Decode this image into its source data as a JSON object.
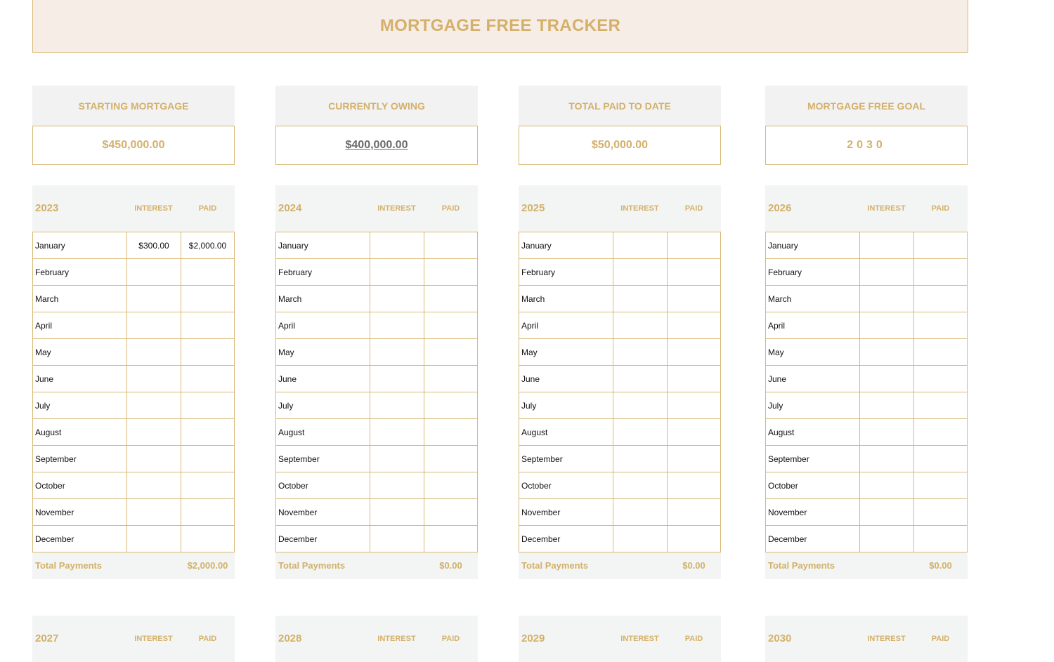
{
  "title": "MORTGAGE FREE TRACKER",
  "stats": [
    {
      "label": "STARTING MORTGAGE",
      "value": "$450,000.00"
    },
    {
      "label": "CURRENTLY OWING",
      "value": "$400,000.00"
    },
    {
      "label": "TOTAL PAID TO DATE",
      "value": "$50,000.00"
    },
    {
      "label": "MORTGAGE FREE GOAL",
      "value": "2030"
    }
  ],
  "column_headers": {
    "interest": "INTEREST",
    "paid": "PAID"
  },
  "total_label": "Total Payments",
  "months": [
    "January",
    "February",
    "March",
    "April",
    "May",
    "June",
    "July",
    "August",
    "September",
    "October",
    "November",
    "December"
  ],
  "years": [
    {
      "year": "2023",
      "rows": [
        {
          "interest": "$300.00",
          "paid": "$2,000.00"
        }
      ],
      "total": "$2,000.00"
    },
    {
      "year": "2024",
      "rows": [],
      "total": "$0.00"
    },
    {
      "year": "2025",
      "rows": [],
      "total": "$0.00"
    },
    {
      "year": "2026",
      "rows": [],
      "total": "$0.00"
    },
    {
      "year": "2027",
      "rows": [],
      "total": ""
    },
    {
      "year": "2028",
      "rows": [],
      "total": ""
    },
    {
      "year": "2029",
      "rows": [],
      "total": ""
    },
    {
      "year": "2030",
      "rows": [],
      "total": ""
    }
  ],
  "colors": {
    "accent": "#d4b06a",
    "border": "#d9b877",
    "title_bg": "#f7ede7",
    "header_bg": "#f2f5f3",
    "label_bg": "#f2f2f2"
  }
}
